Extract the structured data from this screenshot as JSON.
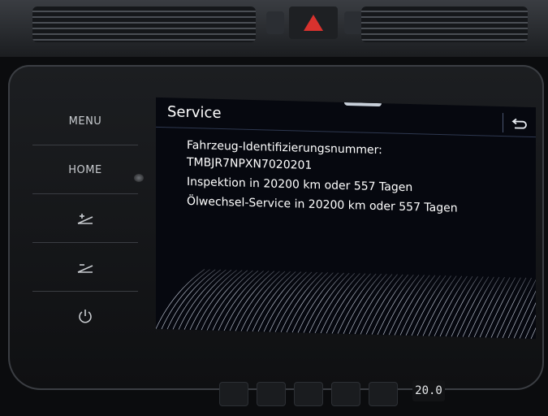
{
  "sidebar": {
    "items": [
      {
        "label": "MENU",
        "icon": "menu-button"
      },
      {
        "label": "HOME",
        "icon": "home-button"
      },
      {
        "label": "",
        "icon": "brightness-up-icon"
      },
      {
        "label": "",
        "icon": "brightness-down-icon"
      },
      {
        "label": "",
        "icon": "power-icon"
      }
    ]
  },
  "screen": {
    "title": "Service",
    "back_icon": "back-arrow-icon",
    "lines": [
      "Fahrzeug-Identifizierungsnummer:",
      "TMBJR7NPXN7020201",
      "Inspektion in 20200 km oder 557 Tagen",
      "Ölwechsel-Service in 20200 km oder 557 Tagen"
    ]
  },
  "climate": {
    "temperature": "20.0"
  },
  "colors": {
    "screen_bg": "#06080f",
    "text": "#ffffff",
    "hazard": "#d8322e"
  }
}
